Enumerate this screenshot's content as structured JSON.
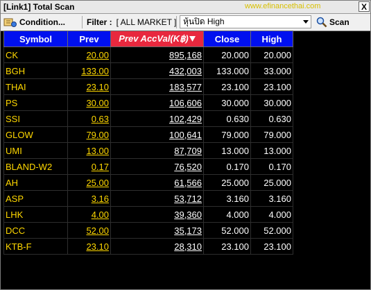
{
  "window": {
    "title": "[Link1] Total Scan",
    "watermark": "www.efinancethai.com",
    "close_label": "X"
  },
  "toolbar": {
    "condition_label": "Condition...",
    "filter_label": "Filter :",
    "filter_value": "[ ALL MARKET ]",
    "scan_select_value": "หุ้นปิด High",
    "scan_label": "Scan"
  },
  "table": {
    "columns": [
      "Symbol",
      "Prev",
      "Prev AccVal(K฿)",
      "Close",
      "High"
    ],
    "rows": [
      [
        "CK",
        "20.00",
        "895,168",
        "20.000",
        "20.000"
      ],
      [
        "BGH",
        "133.00",
        "432,003",
        "133.000",
        "33.000"
      ],
      [
        "THAI",
        "23.10",
        "183,577",
        "23.100",
        "23.100"
      ],
      [
        "PS",
        "30.00",
        "106,606",
        "30.000",
        "30.000"
      ],
      [
        "SSI",
        "0.63",
        "102,429",
        "0.630",
        "0.630"
      ],
      [
        "GLOW",
        "79.00",
        "100,641",
        "79.000",
        "79.000"
      ],
      [
        "UMI",
        "13.00",
        "87,709",
        "13.000",
        "13.000"
      ],
      [
        "BLAND-W2",
        "0.17",
        "76,520",
        "0.170",
        "0.170"
      ],
      [
        "AH",
        "25.00",
        "61,566",
        "25.000",
        "25.000"
      ],
      [
        "ASP",
        "3.16",
        "53,712",
        "3.160",
        "3.160"
      ],
      [
        "LHK",
        "4.00",
        "39,360",
        "4.000",
        "4.000"
      ],
      [
        "DCC",
        "52.00",
        "35,173",
        "52.000",
        "52.000"
      ],
      [
        "KTB-F",
        "23.10",
        "28,310",
        "23.100",
        "23.100"
      ]
    ]
  },
  "colors": {
    "header_bg": "#0010ef",
    "sorted_header_bg": "#e8283e",
    "symbol_text": "#ffd800",
    "value_text": "#ffffff",
    "grid_bg": "#000000"
  },
  "icons": [
    "condition-icon",
    "funnel-icon",
    "dropdown-arrow-icon",
    "magnifier-icon",
    "sort-desc-icon",
    "close-icon"
  ]
}
